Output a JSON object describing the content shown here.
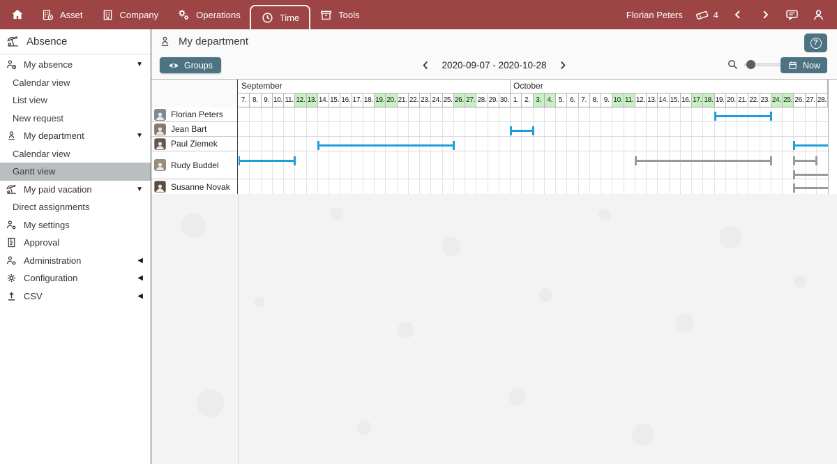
{
  "colors": {
    "topbar": "#9d4545",
    "button_teal": "#4d7383",
    "bar_blue": "#1f9dd9",
    "bar_gray": "#999999",
    "weekend_green": "#c9f0c5",
    "selected_item": "#b9bec1"
  },
  "topbar": {
    "items": [
      {
        "icon": "home-icon",
        "label": ""
      },
      {
        "icon": "building-clock-icon",
        "label": "Asset"
      },
      {
        "icon": "building-icon",
        "label": "Company"
      },
      {
        "icon": "gears-icon",
        "label": "Operations"
      },
      {
        "icon": "clock-icon",
        "label": "Time",
        "active": true
      },
      {
        "icon": "archive-box-icon",
        "label": "Tools"
      }
    ],
    "user": "Florian Peters",
    "ticket_count": "4"
  },
  "sidebar": {
    "title": "Absence",
    "items": [
      {
        "kind": "section",
        "icon": "person-clock-icon",
        "label": "My absence",
        "arrow": "down"
      },
      {
        "kind": "sub",
        "label": "Calendar view"
      },
      {
        "kind": "sub",
        "label": "List view"
      },
      {
        "kind": "sub",
        "label": "New request"
      },
      {
        "kind": "section",
        "icon": "person-icon",
        "label": "My department",
        "arrow": "down"
      },
      {
        "kind": "sub",
        "label": "Calendar view"
      },
      {
        "kind": "sub",
        "label": "Gantt view",
        "selected": true
      },
      {
        "kind": "section",
        "icon": "beach-icon",
        "label": "My paid vacation",
        "arrow": "down"
      },
      {
        "kind": "sub",
        "label": "Direct assignments"
      },
      {
        "kind": "section",
        "icon": "person-gear-icon",
        "label": "My settings"
      },
      {
        "kind": "section",
        "icon": "document-icon",
        "label": "Approval"
      },
      {
        "kind": "section",
        "icon": "person-gear-icon",
        "label": "Administration",
        "arrow": "left"
      },
      {
        "kind": "section",
        "icon": "gear-icon",
        "label": "Configuration",
        "arrow": "left"
      },
      {
        "kind": "section",
        "icon": "upload-icon",
        "label": "CSV",
        "arrow": "left"
      }
    ]
  },
  "main": {
    "title": "My department",
    "help_label": "?",
    "toolbar": {
      "groups_label": "Groups",
      "date_range": "2020-09-07 - 2020-10-28",
      "now_label": "Now"
    }
  },
  "gantt": {
    "months": [
      {
        "name": "September",
        "days": [
          7,
          8,
          9,
          10,
          11,
          12,
          13,
          14,
          15,
          16,
          17,
          18,
          19,
          20,
          21,
          22,
          23,
          24,
          25,
          26,
          27,
          28,
          29,
          30
        ],
        "weekend_days": [
          12,
          13,
          19,
          20,
          26,
          27
        ]
      },
      {
        "name": "October",
        "days": [
          1,
          2,
          3,
          4,
          5,
          6,
          7,
          8,
          9,
          10,
          11,
          12,
          13,
          14,
          15,
          16,
          17,
          18,
          19,
          20,
          21,
          22,
          23,
          24,
          25,
          26,
          27,
          28
        ],
        "weekend_days": [
          3,
          4,
          10,
          11,
          17,
          18,
          24,
          25
        ]
      }
    ],
    "rows": [
      {
        "name": "Florian Peters",
        "avatar_color": "#7d8a95",
        "lines": 1,
        "bars": [
          {
            "start_date": "2020-10-19",
            "end_date": "2020-10-23",
            "start": 42,
            "end": 47,
            "color": "blue",
            "line": 0
          }
        ]
      },
      {
        "name": "Jean Bart",
        "avatar_color": "#8a7a66",
        "lines": 1,
        "bars": [
          {
            "start_date": "2020-10-01",
            "end_date": "2020-10-02",
            "start": 24,
            "end": 26,
            "color": "blue",
            "line": 0
          }
        ]
      },
      {
        "name": "Paul Ziemek",
        "avatar_color": "#6b5546",
        "lines": 1,
        "bars": [
          {
            "start_date": "2020-09-14",
            "end_date": "2020-09-25",
            "start": 7,
            "end": 19,
            "color": "blue",
            "line": 0
          },
          {
            "start_date": "2020-10-26",
            "end_date": "2020-10-28",
            "start": 49,
            "end": 52,
            "color": "blue",
            "line": 0,
            "clipped_right": true
          }
        ]
      },
      {
        "name": "Rudy Buddel",
        "avatar_color": "#9a8d7d",
        "lines": 2,
        "bars": [
          {
            "start_date": "2020-09-07",
            "end_date": "2020-09-11",
            "start": 0,
            "end": 5,
            "color": "blue",
            "line": 0
          },
          {
            "start_date": "2020-10-12",
            "end_date": "2020-10-23",
            "start": 35,
            "end": 47,
            "color": "gray",
            "line": 0
          },
          {
            "start_date": "2020-10-26",
            "end_date": "2020-10-27",
            "start": 49,
            "end": 51,
            "color": "gray",
            "line": 0
          },
          {
            "start_date": "2020-10-26",
            "end_date": "2020-10-28",
            "start": 49,
            "end": 52,
            "color": "gray",
            "line": 1,
            "clipped_right": true
          }
        ]
      },
      {
        "name": "Susanne Novak",
        "avatar_color": "#5f4a3a",
        "lines": 1,
        "bars": [
          {
            "start_date": "2020-10-26",
            "end_date": "2020-10-28",
            "start": 49,
            "end": 52,
            "color": "gray",
            "line": 0,
            "clipped_right": true
          }
        ]
      }
    ]
  }
}
